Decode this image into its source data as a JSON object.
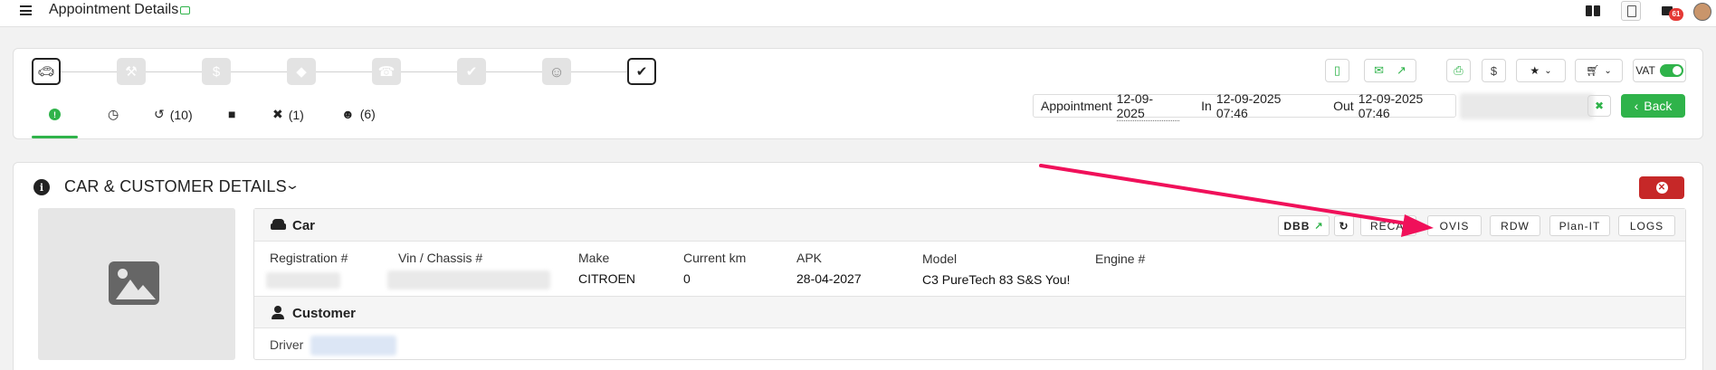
{
  "header": {
    "title": "Appointment Details",
    "notification_count": "61"
  },
  "progress_steps": [
    {
      "name": "car",
      "icon": "car-icon",
      "active": true
    },
    {
      "name": "tools",
      "icon": "wrench-icon",
      "active": false
    },
    {
      "name": "price",
      "icon": "dollar-icon",
      "active": false
    },
    {
      "name": "tag",
      "icon": "tag-icon",
      "active": false
    },
    {
      "name": "call",
      "icon": "phone-icon",
      "active": false
    },
    {
      "name": "assign",
      "icon": "user-check-icon",
      "active": false
    },
    {
      "name": "customer",
      "icon": "face-icon",
      "active": false
    },
    {
      "name": "done",
      "icon": "check-double-icon",
      "active": true
    }
  ],
  "subtabs": [
    {
      "icon": "info-icon",
      "label": ""
    },
    {
      "icon": "clock-icon",
      "label": ""
    },
    {
      "icon": "history-icon",
      "label": "(10)"
    },
    {
      "icon": "note-icon",
      "label": ""
    },
    {
      "icon": "tools-icon",
      "label": "(1)"
    },
    {
      "icon": "users-icon",
      "label": "(6)"
    }
  ],
  "actions": {
    "vat_label": "VAT",
    "vat_enabled": true,
    "back_label": "Back"
  },
  "dates": {
    "appointment_label": "Appointment",
    "appointment_value": "12-09-2025",
    "in_label": "In",
    "in_value": "12-09-2025 07:46",
    "out_label": "Out",
    "out_value": "12-09-2025 07:46"
  },
  "section": {
    "title": "CAR & CUSTOMER DETAILS"
  },
  "car": {
    "heading": "Car",
    "buttons": {
      "dbb": "DBB",
      "recalls": "RECALLS",
      "ovis": "OVIS",
      "rdw": "RDW",
      "planit": "Plan-IT",
      "logs": "LOGS"
    },
    "columns": {
      "registration": "Registration #",
      "vin": "Vin / Chassis #",
      "make": "Make",
      "km": "Current km",
      "apk": "APK",
      "model": "Model",
      "engine": "Engine #"
    },
    "values": {
      "make": "CITROEN",
      "km": "0",
      "apk": "28-04-2027",
      "model": "C3 PureTech 83 S&S You!"
    }
  },
  "customer": {
    "heading": "Customer",
    "driver_label": "Driver"
  },
  "colors": {
    "accent_green": "#2fb34a",
    "danger_red": "#c62828",
    "annotation_arrow": "#f0105a"
  }
}
